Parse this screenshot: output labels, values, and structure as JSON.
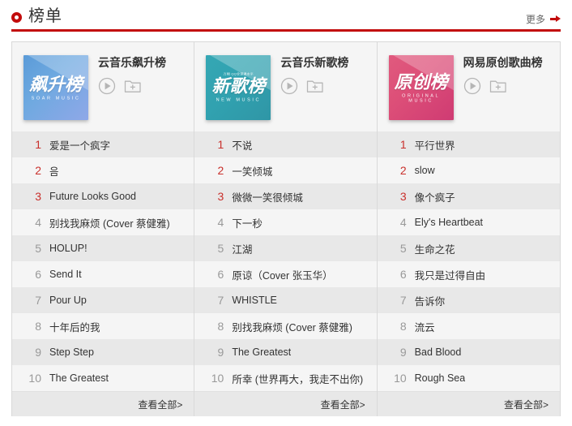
{
  "header": {
    "icon": "ring-icon",
    "title": "榜单",
    "more_label": "更多",
    "more_arrow_icon": "arrow-right-icon",
    "accent_color": "#c20c0c"
  },
  "columns": [
    {
      "title": "云音乐飙升榜",
      "cover": {
        "tiny_text": "",
        "zh_text": "飙升榜",
        "en_text": "SOAR MUSIC",
        "theme": "cover-blue"
      },
      "play_label": "play-icon",
      "add_label": "add-to-playlist-icon",
      "footer_label": "查看全部>",
      "songs": [
        {
          "rank": "1",
          "name": "爱是一个疯字"
        },
        {
          "rank": "2",
          "name": "음"
        },
        {
          "rank": "3",
          "name": "Future Looks Good"
        },
        {
          "rank": "4",
          "name": "别找我麻烦 (Cover 蔡健雅)"
        },
        {
          "rank": "5",
          "name": "HOLUP!"
        },
        {
          "rank": "6",
          "name": "Send It"
        },
        {
          "rank": "7",
          "name": "Pour Up"
        },
        {
          "rank": "8",
          "name": "十年后的我"
        },
        {
          "rank": "9",
          "name": "Step Step"
        },
        {
          "rank": "10",
          "name": "The Greatest"
        }
      ]
    },
    {
      "title": "云音乐新歌榜",
      "cover": {
        "tiny_text": "万物 QQ全球通水平",
        "zh_text": "新歌榜",
        "en_text": "NEW MUSIC",
        "theme": "cover-teal"
      },
      "play_label": "play-icon",
      "add_label": "add-to-playlist-icon",
      "footer_label": "查看全部>",
      "songs": [
        {
          "rank": "1",
          "name": "不说"
        },
        {
          "rank": "2",
          "name": "一笑倾城"
        },
        {
          "rank": "3",
          "name": "微微一笑很倾城"
        },
        {
          "rank": "4",
          "name": "下一秒"
        },
        {
          "rank": "5",
          "name": "江湖"
        },
        {
          "rank": "6",
          "name": "原谅（Cover 张玉华）"
        },
        {
          "rank": "7",
          "name": "WHISTLE"
        },
        {
          "rank": "8",
          "name": "别找我麻烦 (Cover 蔡健雅)"
        },
        {
          "rank": "9",
          "name": "The Greatest"
        },
        {
          "rank": "10",
          "name": "所幸 (世界再大，我走不出你)"
        }
      ]
    },
    {
      "title": "网易原创歌曲榜",
      "cover": {
        "tiny_text": "",
        "zh_text": "原创榜",
        "en_text": "ORIGINAL MUSIC",
        "theme": "cover-pink"
      },
      "play_label": "play-icon",
      "add_label": "add-to-playlist-icon",
      "footer_label": "查看全部>",
      "songs": [
        {
          "rank": "1",
          "name": "平行世界"
        },
        {
          "rank": "2",
          "name": "slow"
        },
        {
          "rank": "3",
          "name": "像个疯子"
        },
        {
          "rank": "4",
          "name": "Ely's Heartbeat"
        },
        {
          "rank": "5",
          "name": "生命之花"
        },
        {
          "rank": "6",
          "name": "我只是过得自由"
        },
        {
          "rank": "7",
          "name": "告诉你"
        },
        {
          "rank": "8",
          "name": "流云"
        },
        {
          "rank": "9",
          "name": "Bad Blood"
        },
        {
          "rank": "10",
          "name": "Rough Sea"
        }
      ]
    }
  ]
}
